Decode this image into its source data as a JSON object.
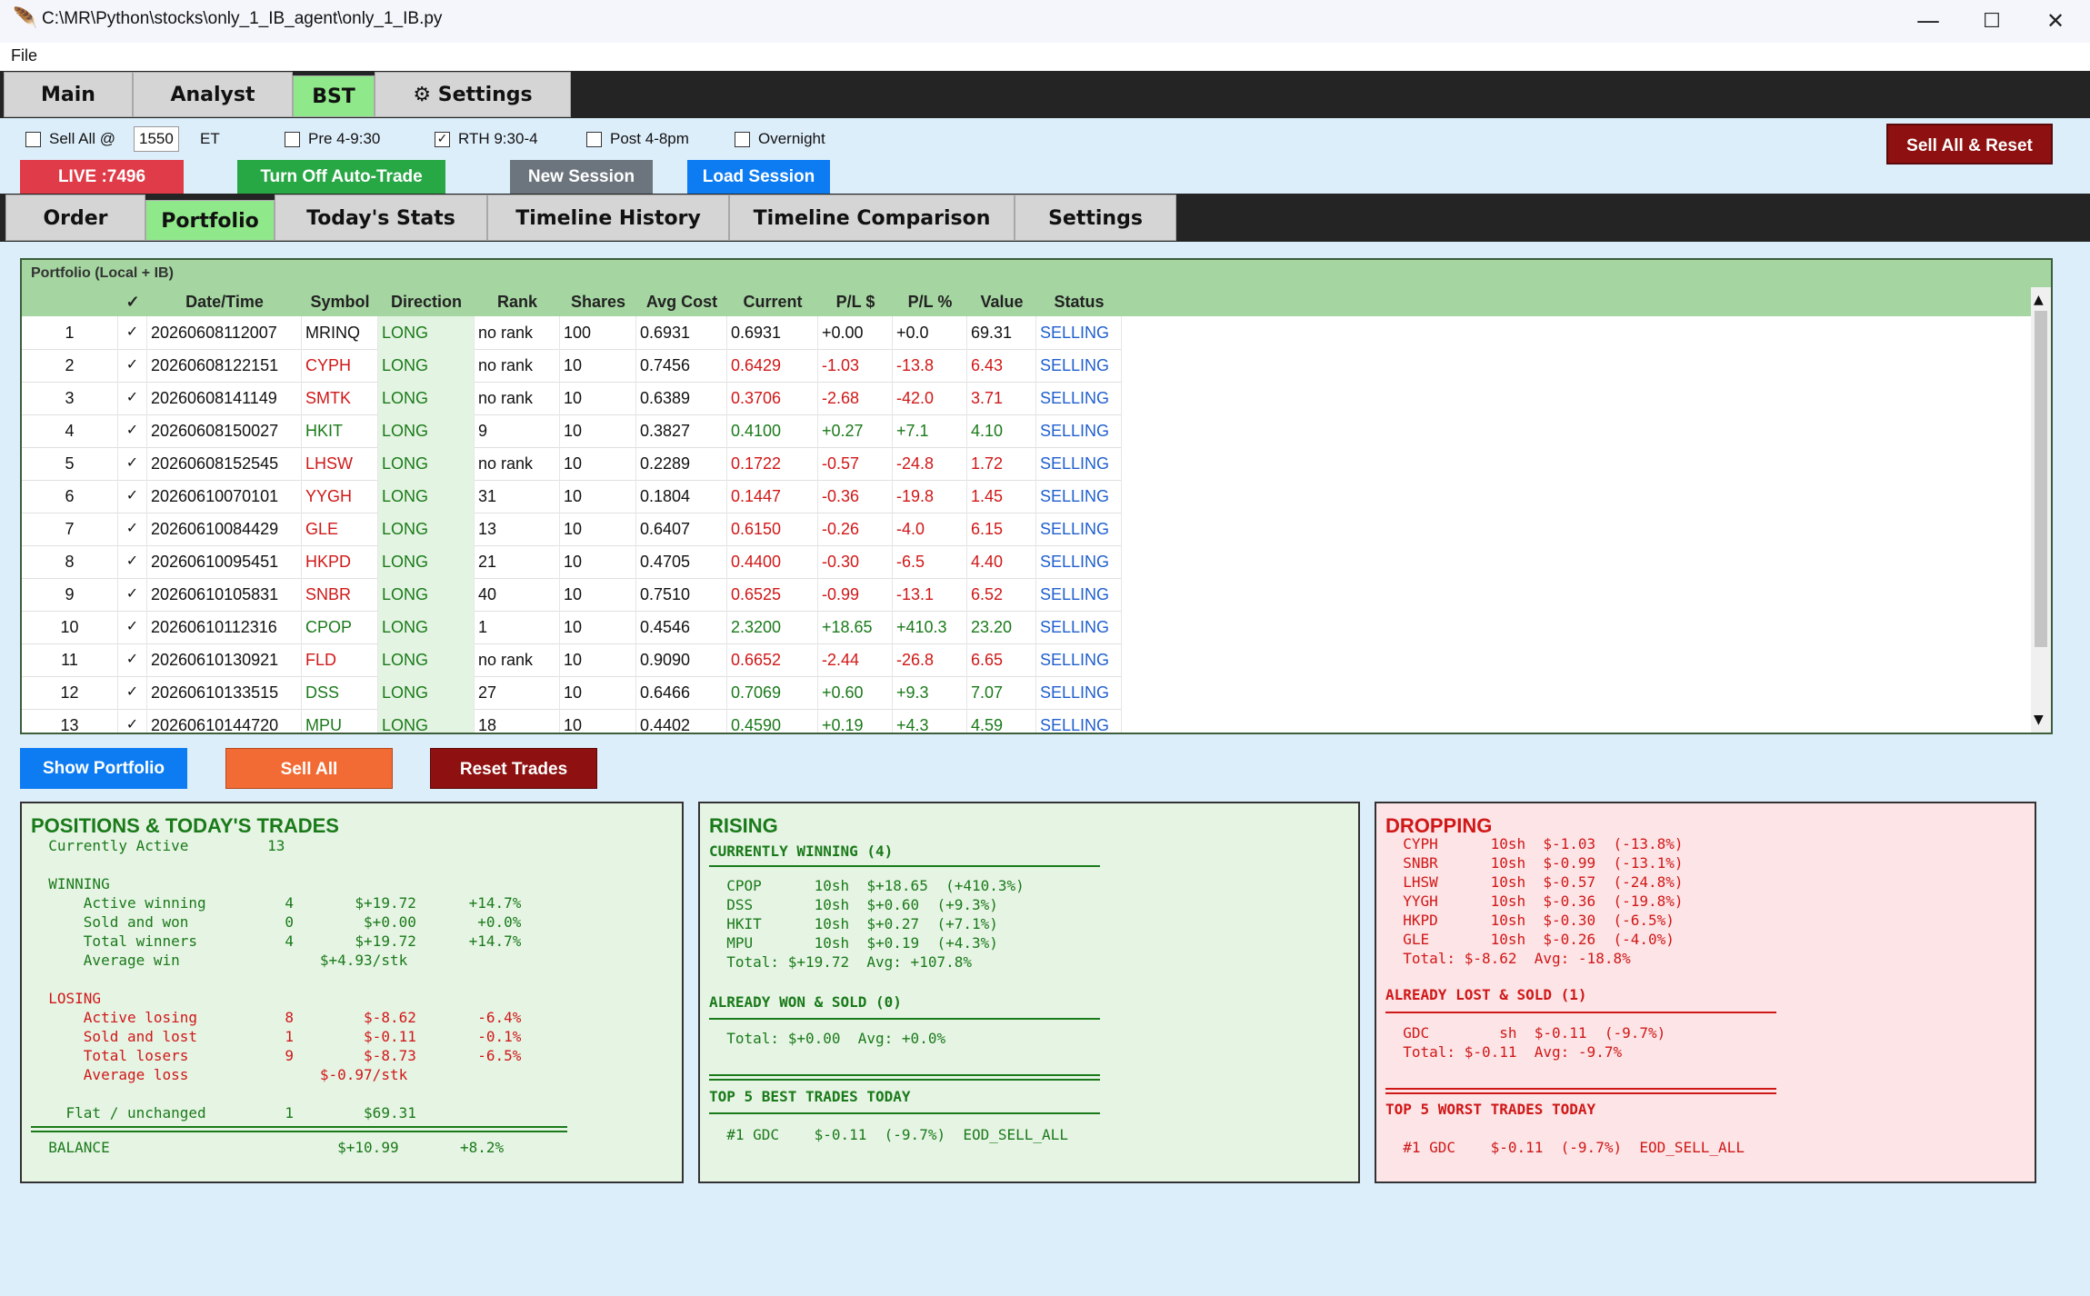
{
  "window": {
    "title": "C:\\MR\\Python\\stocks\\only_1_IB_agent\\only_1_IB.py",
    "min": "—",
    "max": "☐",
    "close": "✕"
  },
  "menu": {
    "file": "File"
  },
  "main_tabs": [
    "Main",
    "Analyst",
    "BST",
    "Settings"
  ],
  "controls": {
    "sell_all_at": "Sell All @",
    "sell_all_time": "1550",
    "tz": "ET",
    "pre": "Pre 4-9:30",
    "rth": "RTH 9:30-4",
    "post": "Post 4-8pm",
    "overnight": "Overnight",
    "rth_check": "✓",
    "sell_all_reset": "Sell All & Reset",
    "live": "LIVE :7496",
    "auto_trade": "Turn Off Auto-Trade",
    "new_session": "New Session",
    "load_session": "Load Session"
  },
  "sub_tabs": [
    "Order",
    "Portfolio",
    "Today's Stats",
    "Timeline History",
    "Timeline Comparison",
    "Settings"
  ],
  "portfolio": {
    "caption": "Portfolio (Local + IB)",
    "headers": [
      "",
      "✓",
      "Date/Time",
      "Symbol",
      "Direction",
      "Rank",
      "Shares",
      "Avg Cost",
      "Current",
      "P/L $",
      "P/L %",
      "Value",
      "Status"
    ],
    "rows": [
      [
        "1",
        "✓",
        "20260608112007",
        "MRINQ",
        "LONG",
        "no rank",
        "100",
        "0.6931",
        "0.6931",
        "+0.00",
        "+0.0",
        "69.31",
        "SELLING"
      ],
      [
        "2",
        "✓",
        "20260608122151",
        "CYPH",
        "LONG",
        "no rank",
        "10",
        "0.7456",
        "0.6429",
        "-1.03",
        "-13.8",
        "6.43",
        "SELLING"
      ],
      [
        "3",
        "✓",
        "20260608141149",
        "SMTK",
        "LONG",
        "no rank",
        "10",
        "0.6389",
        "0.3706",
        "-2.68",
        "-42.0",
        "3.71",
        "SELLING"
      ],
      [
        "4",
        "✓",
        "20260608150027",
        "HKIT",
        "LONG",
        "9",
        "10",
        "0.3827",
        "0.4100",
        "+0.27",
        "+7.1",
        "4.10",
        "SELLING"
      ],
      [
        "5",
        "✓",
        "20260608152545",
        "LHSW",
        "LONG",
        "no rank",
        "10",
        "0.2289",
        "0.1722",
        "-0.57",
        "-24.8",
        "1.72",
        "SELLING"
      ],
      [
        "6",
        "✓",
        "20260610070101",
        "YYGH",
        "LONG",
        "31",
        "10",
        "0.1804",
        "0.1447",
        "-0.36",
        "-19.8",
        "1.45",
        "SELLING"
      ],
      [
        "7",
        "✓",
        "20260610084429",
        "GLE",
        "LONG",
        "13",
        "10",
        "0.6407",
        "0.6150",
        "-0.26",
        "-4.0",
        "6.15",
        "SELLING"
      ],
      [
        "8",
        "✓",
        "20260610095451",
        "HKPD",
        "LONG",
        "21",
        "10",
        "0.4705",
        "0.4400",
        "-0.30",
        "-6.5",
        "4.40",
        "SELLING"
      ],
      [
        "9",
        "✓",
        "20260610105831",
        "SNBR",
        "LONG",
        "40",
        "10",
        "0.7510",
        "0.6525",
        "-0.99",
        "-13.1",
        "6.52",
        "SELLING"
      ],
      [
        "10",
        "✓",
        "20260610112316",
        "CPOP",
        "LONG",
        "1",
        "10",
        "0.4546",
        "2.3200",
        "+18.65",
        "+410.3",
        "23.20",
        "SELLING"
      ],
      [
        "11",
        "✓",
        "20260610130921",
        "FLD",
        "LONG",
        "no rank",
        "10",
        "0.9090",
        "0.6652",
        "-2.44",
        "-26.8",
        "6.65",
        "SELLING"
      ],
      [
        "12",
        "✓",
        "20260610133515",
        "DSS",
        "LONG",
        "27",
        "10",
        "0.6466",
        "0.7069",
        "+0.60",
        "+9.3",
        "7.07",
        "SELLING"
      ],
      [
        "13",
        "✓",
        "20260610144720",
        "MPU",
        "LONG",
        "18",
        "10",
        "0.4402",
        "0.4590",
        "+0.19",
        "+4.3",
        "4.59",
        "SELLING"
      ]
    ],
    "row_sign": [
      "flat",
      "neg",
      "neg",
      "pos",
      "neg",
      "neg",
      "neg",
      "neg",
      "neg",
      "pos",
      "neg",
      "pos",
      "pos"
    ]
  },
  "actions": {
    "show": "Show Portfolio",
    "sell_all": "Sell All",
    "reset": "Reset Trades"
  },
  "positions": {
    "title": "POSITIONS & TODAY'S TRADES",
    "lines": [
      {
        "t": "  Currently Active         13",
        "c": "g"
      },
      {
        "t": "",
        "c": "g"
      },
      {
        "t": "  WINNING",
        "c": "g"
      },
      {
        "t": "      Active winning         4       $+19.72      +14.7%",
        "c": "g"
      },
      {
        "t": "      Sold and won           0        $+0.00       +0.0%",
        "c": "g"
      },
      {
        "t": "      Total winners          4       $+19.72      +14.7%",
        "c": "g"
      },
      {
        "t": "      Average win                $+4.93/stk",
        "c": "g"
      },
      {
        "t": "",
        "c": "g"
      },
      {
        "t": "  LOSING",
        "c": "r"
      },
      {
        "t": "      Active losing          8        $-8.62       -6.4%",
        "c": "r"
      },
      {
        "t": "      Sold and lost          1        $-0.11       -0.1%",
        "c": "r"
      },
      {
        "t": "      Total losers           9        $-8.73       -6.5%",
        "c": "r"
      },
      {
        "t": "      Average loss               $-0.97/stk",
        "c": "r"
      },
      {
        "t": "",
        "c": "g"
      },
      {
        "t": "    Flat / unchanged         1        $69.31",
        "c": "g"
      }
    ],
    "balance": "  BALANCE                          $+10.99       +8.2%"
  },
  "rising": {
    "title": "RISING",
    "winning_hdr": "CURRENTLY WINNING (4)",
    "winning": [
      "  CPOP      10sh  $+18.65  (+410.3%)",
      "  DSS       10sh  $+0.60  (+9.3%)",
      "  HKIT      10sh  $+0.27  (+7.1%)",
      "  MPU       10sh  $+0.19  (+4.3%)",
      "  Total: $+19.72  Avg: +107.8%"
    ],
    "sold_hdr": "ALREADY WON & SOLD (0)",
    "sold_total": "  Total: $+0.00  Avg: +0.0%",
    "top5_hdr": "TOP 5 BEST TRADES TODAY",
    "top5": "  #1 GDC    $-0.11  (-9.7%)  EOD_SELL_ALL"
  },
  "dropping": {
    "title": "DROPPING",
    "losing": [
      "  CYPH      10sh  $-1.03  (-13.8%)",
      "  SNBR      10sh  $-0.99  (-13.1%)",
      "  LHSW      10sh  $-0.57  (-24.8%)",
      "  YYGH      10sh  $-0.36  (-19.8%)",
      "  HKPD      10sh  $-0.30  (-6.5%)",
      "  GLE       10sh  $-0.26  (-4.0%)",
      "  Total: $-8.62  Avg: -18.8%"
    ],
    "sold_hdr": "ALREADY LOST & SOLD (1)",
    "sold": [
      "  GDC        sh  $-0.11  (-9.7%)",
      "  Total: $-0.11  Avg: -9.7%"
    ],
    "top5_hdr": "TOP 5 WORST TRADES TODAY",
    "top5": "  #1 GDC    $-0.11  (-9.7%)  EOD_SELL_ALL"
  },
  "colors": {
    "green": "#1a7a1a",
    "red": "#d01818",
    "blue": "#1f5fcf",
    "accent": "#8fe889"
  }
}
